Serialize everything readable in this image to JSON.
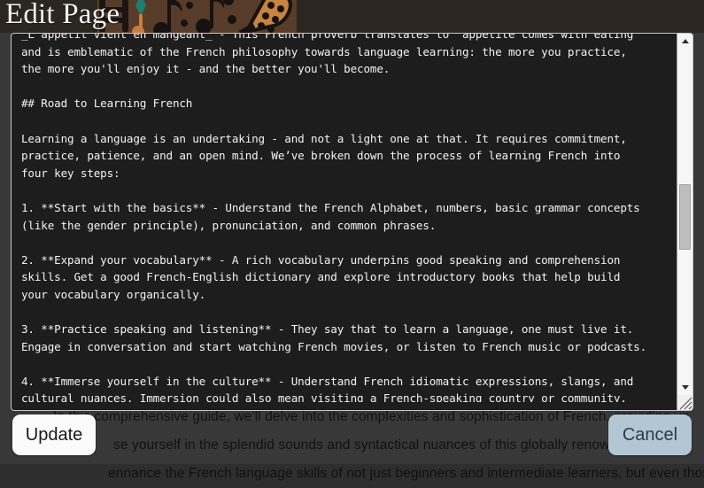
{
  "header": {
    "title": "Edit Page",
    "background_color": "#2b2720",
    "decoration": "musical-notes-and-guitar-illustration"
  },
  "editor": {
    "name": "page-content-markdown-editor",
    "background_color": "#1d1d1d",
    "text_color": "#f2f2f2",
    "content": "_L'appetit vient en mangeant_ - This French proverb translates to \"appetite comes with eating\"\nand is emblematic of the French philosophy towards language learning: the more you practice,\nthe more you'll enjoy it - and the better you'll become.\n\n## Road to Learning French\n\nLearning a language is an undertaking - and not a light one at that. It requires commitment,\npractice, patience, and an open mind. We’ve broken down the process of learning French into\nfour key steps:\n\n1. **Start with the basics** - Understand the French Alphabet, numbers, basic grammar concepts\n(like the gender principle), pronunciation, and common phrases.\n\n2. **Expand your vocabulary** - A rich vocabulary underpins good speaking and comprehension\nskills. Get a good French-English dictionary and explore introductory books that help build\nyour vocabulary organically.\n\n3. **Practice speaking and listening** - They say that to learn a language, one must live it.\nEngage in conversation and start watching French movies, or listen to French music or podcasts.\n\n4. **Immerse yourself in the culture** - Understand French idiomatic expressions, slangs, and\ncultural nuances. Immersion could also mean visiting a French-speaking country or community."
  },
  "scrollbar": {
    "up_arrow": "scroll-up-arrow-icon",
    "down_arrow": "scroll-down-arrow-icon",
    "thumb_position_percent": 40
  },
  "footer": {
    "update_label": "Update",
    "cancel_label": "Cancel",
    "update_color": "#fbfbfb",
    "cancel_color": "#b3c6d4"
  },
  "backdrop": {
    "line1": "In this comprehensive guide, we'll delve into the complexities and sophistication of French, providing yo",
    "line2": "se yourself in the splendid sounds and syntactical nuances of this globally renown            T",
    "line3": "ennance the French language skills of not just beginners and intermediate learners, but even those who"
  }
}
